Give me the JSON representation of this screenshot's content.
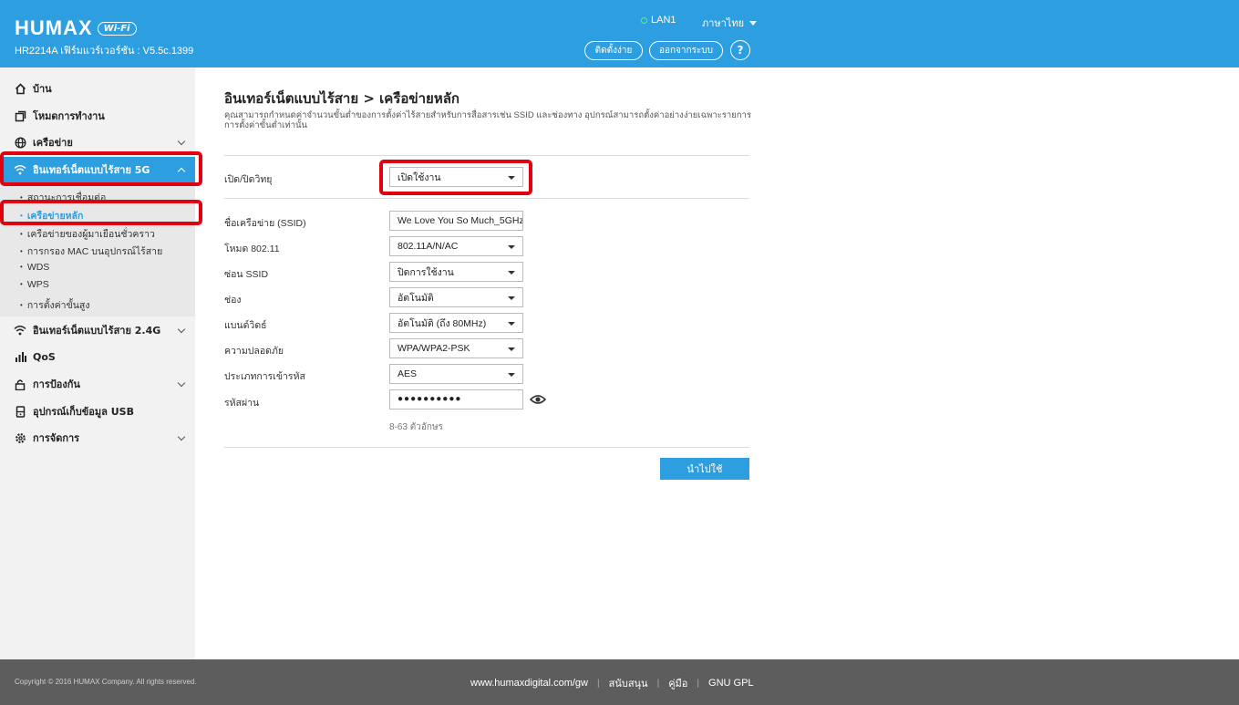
{
  "header": {
    "brand": "HUMAX",
    "brand_badge": "Wi-Fi",
    "model_line": "HR2214A เฟิร์มแวร์เวอร์ชัน : V5.5c.1399",
    "lan_status": "LAN1",
    "language": "ภาษาไทย",
    "easy_setup": "ติดตั้งง่าย",
    "logout": "ออกจากระบบ",
    "help": "?"
  },
  "sidebar": {
    "items": [
      {
        "label": "บ้าน",
        "icon": "home-icon"
      },
      {
        "label": "โหมดการทำงาน",
        "icon": "mode-icon"
      },
      {
        "label": "เครือข่าย",
        "icon": "globe-icon"
      },
      {
        "label": "อินเทอร์เน็ตแบบไร้สาย 5G",
        "icon": "wifi-icon"
      },
      {
        "label": "อินเทอร์เน็ตแบบไร้สาย 2.4G",
        "icon": "wifi-icon"
      },
      {
        "label": "QoS",
        "icon": "bar-chart-icon"
      },
      {
        "label": "การป้องกัน",
        "icon": "lock-icon"
      },
      {
        "label": "อุปกรณ์เก็บข้อมูล USB",
        "icon": "usb-storage-icon"
      },
      {
        "label": "การจัดการ",
        "icon": "gear-icon"
      }
    ],
    "sub_items": [
      "สถานะการเชื่อมต่อ",
      "เครือข่ายหลัก",
      "เครือข่ายของผู้มาเยือนชั่วคราว",
      "การกรอง MAC บนอุปกรณ์ไร้สาย",
      "WDS",
      "WPS",
      "การตั้งค่าขั้นสูง"
    ],
    "accent_color": "#2d9ee0"
  },
  "main": {
    "title": "อินเทอร์เน็ตแบบไร้สาย > เครือข่ายหลัก",
    "description": "คุณสามารถกำหนดค่าจำนวนขั้นต่ำของการตั้งค่าไร้สายสำหรับการสื่อสารเช่น SSID และช่องทาง อุปกรณ์สามารถตั้งค่าอย่างง่ายเฉพาะรายการการตั้งค่าขั้นต่ำเท่านั้น",
    "radio": {
      "label": "เปิด/ปิดวิทยุ",
      "value": "เปิดใช้งาน"
    },
    "fields": {
      "ssid": {
        "label": "ชื่อเครือข่าย (SSID)",
        "value": "We Love You So Much_5GHz"
      },
      "mode": {
        "label": "โหมด 802.11",
        "value": "802.11A/N/AC"
      },
      "hide_ssid": {
        "label": "ซ่อน SSID",
        "value": "ปิดการใช้งาน"
      },
      "channel": {
        "label": "ช่อง",
        "value": "อัตโนมัติ"
      },
      "bandwidth": {
        "label": "แบนด์วิดธ์",
        "value": "อัตโนมัติ (ถึง 80MHz)"
      },
      "security": {
        "label": "ความปลอดภัย",
        "value": "WPA/WPA2-PSK"
      },
      "encryption": {
        "label": "ประเภทการเข้ารหัส",
        "value": "AES"
      },
      "password": {
        "label": "รหัสผ่าน",
        "value": "●●●●●●●●●●"
      }
    },
    "password_hint": "8-63 ตัวอักษร",
    "apply": "นำไปใช้"
  },
  "footer": {
    "copyright": "Copyright © 2016 HUMAX Company. All rights reserved.",
    "links": [
      "www.humaxdigital.com/gw",
      "สนับสนุน",
      "คู่มือ",
      "GNU GPL"
    ],
    "separator": "|"
  }
}
